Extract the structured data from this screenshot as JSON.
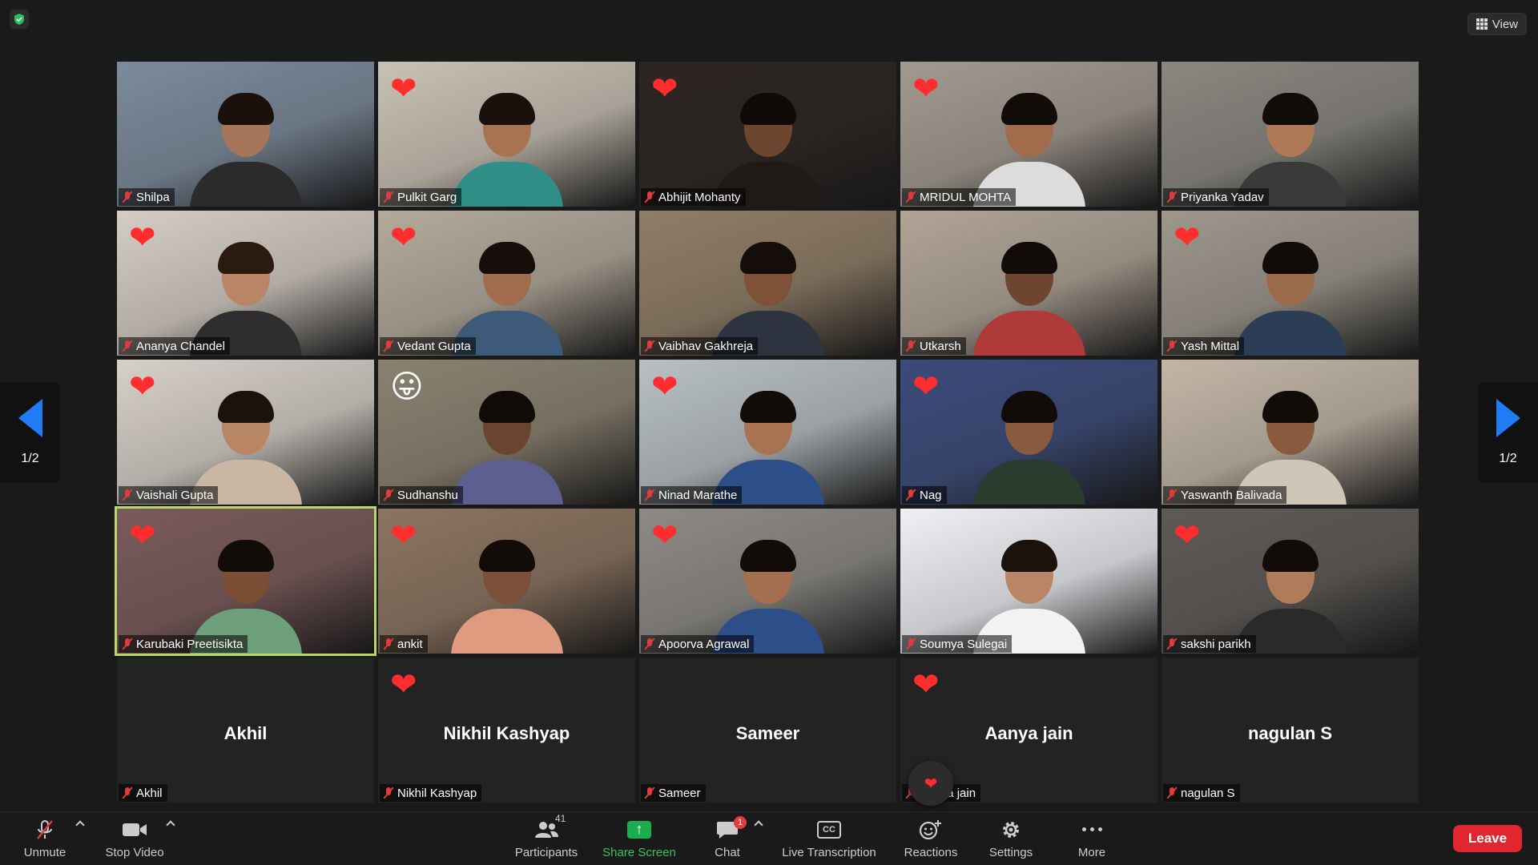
{
  "header": {
    "view_label": "View",
    "shield_icon": "shield-check-icon"
  },
  "pagination": {
    "left": "1/2",
    "right": "1/2"
  },
  "participants": [
    {
      "name": "Shilpa",
      "reaction": "",
      "bg": "#7c8a9b",
      "skin": "#a7765a",
      "shirt": "#2b2b2b",
      "hair": "#1a110c"
    },
    {
      "name": "Pulkit Garg",
      "reaction": "❤",
      "bg": "#c8c1b4",
      "skin": "#a97352",
      "shirt": "#2f8f86",
      "hair": "#1a110c"
    },
    {
      "name": "Abhijit Mohanty",
      "reaction": "❤",
      "bg": "#2c2521",
      "skin": "#6e4630",
      "shirt": "#1f1a17",
      "hair": "#0f0a08"
    },
    {
      "name": "MRIDUL MOHTA",
      "reaction": "❤",
      "bg": "#a29a90",
      "skin": "#a16b4c",
      "shirt": "#dcdcdc",
      "hair": "#120c09"
    },
    {
      "name": "Priyanka Yadav",
      "reaction": "",
      "bg": "#8a8780",
      "skin": "#b07a59",
      "shirt": "#3a3a3a",
      "hair": "#120c09"
    },
    {
      "name": "Ananya Chandel",
      "reaction": "❤",
      "bg": "#d4cdc4",
      "skin": "#b98566",
      "shirt": "#2e2e2e",
      "hair": "#2a1a10"
    },
    {
      "name": "Vedant Gupta",
      "reaction": "❤",
      "bg": "#b3aa9b",
      "skin": "#a06e4e",
      "shirt": "#3d5a78",
      "hair": "#140d09"
    },
    {
      "name": "Vaibhav Gakhreja",
      "reaction": "",
      "bg": "#8f7d66",
      "skin": "#7e5139",
      "shirt": "#2e3340",
      "hair": "#140d09"
    },
    {
      "name": "Utkarsh",
      "reaction": "",
      "bg": "#b0a496",
      "skin": "#6e4630",
      "shirt": "#b03a3a",
      "hair": "#120c09"
    },
    {
      "name": "Yash Mittal",
      "reaction": "❤",
      "bg": "#9d978c",
      "skin": "#9b6a4b",
      "shirt": "#2c3e55",
      "hair": "#120c09"
    },
    {
      "name": "Vaishali Gupta",
      "reaction": "❤",
      "bg": "#d6d0c8",
      "skin": "#b88665",
      "shirt": "#c9b6a3",
      "hair": "#1c120c"
    },
    {
      "name": "Sudhanshu",
      "reaction": "😛",
      "bg": "#8a8270",
      "skin": "#6b442f",
      "shirt": "#5d5f8f",
      "hair": "#110b08"
    },
    {
      "name": "Ninad Marathe",
      "reaction": "❤",
      "bg": "#b8c0c4",
      "skin": "#a97352",
      "shirt": "#2c4f8a",
      "hair": "#120c09"
    },
    {
      "name": "Nag",
      "reaction": "❤",
      "bg": "#3b4b7a",
      "skin": "#8a5a3e",
      "shirt": "#2b3b2e",
      "hair": "#120c09"
    },
    {
      "name": "Yaswanth Balivada",
      "reaction": "",
      "bg": "#c2b6a6",
      "skin": "#8a5a3e",
      "shirt": "#cfc6b8",
      "hair": "#120c09"
    },
    {
      "name": "Karubaki Preetisikta",
      "reaction": "❤",
      "bg": "#7a5a5a",
      "skin": "#7a4e35",
      "shirt": "#6da07a",
      "hair": "#120c09",
      "active": true
    },
    {
      "name": "ankit",
      "reaction": "❤",
      "bg": "#8c7460",
      "skin": "#7a5038",
      "shirt": "#e09a80",
      "hair": "#120c09"
    },
    {
      "name": "Apoorva Agrawal",
      "reaction": "❤",
      "bg": "#8d8a86",
      "skin": "#a36f4f",
      "shirt": "#2c4f8a",
      "hair": "#120c09"
    },
    {
      "name": "Soumya Sulegai",
      "reaction": "",
      "bg": "#eef0f4",
      "skin": "#b98566",
      "shirt": "#f2f2f2",
      "hair": "#1c120c"
    },
    {
      "name": "sakshi parikh",
      "reaction": "❤",
      "bg": "#5e5a56",
      "skin": "#b07b5b",
      "shirt": "#2a2a2a",
      "hair": "#120c09"
    },
    {
      "name": "Akhil",
      "reaction": "",
      "video": false
    },
    {
      "name": "Nikhil Kashyap",
      "reaction": "❤",
      "video": false
    },
    {
      "name": "Sameer",
      "reaction": "",
      "video": false
    },
    {
      "name": "Aanya jain",
      "reaction": "❤",
      "video": false
    },
    {
      "name": "nagulan S",
      "reaction": "",
      "video": false
    }
  ],
  "float_reaction": "❤",
  "toolbar": {
    "unmute": "Unmute",
    "stop_video": "Stop Video",
    "participants": "Participants",
    "participant_count": "41",
    "share_screen": "Share Screen",
    "chat": "Chat",
    "chat_badge": "1",
    "live_transcription": "Live Transcription",
    "cc_text": "CC",
    "reactions": "Reactions",
    "settings": "Settings",
    "more": "More",
    "leave": "Leave"
  }
}
